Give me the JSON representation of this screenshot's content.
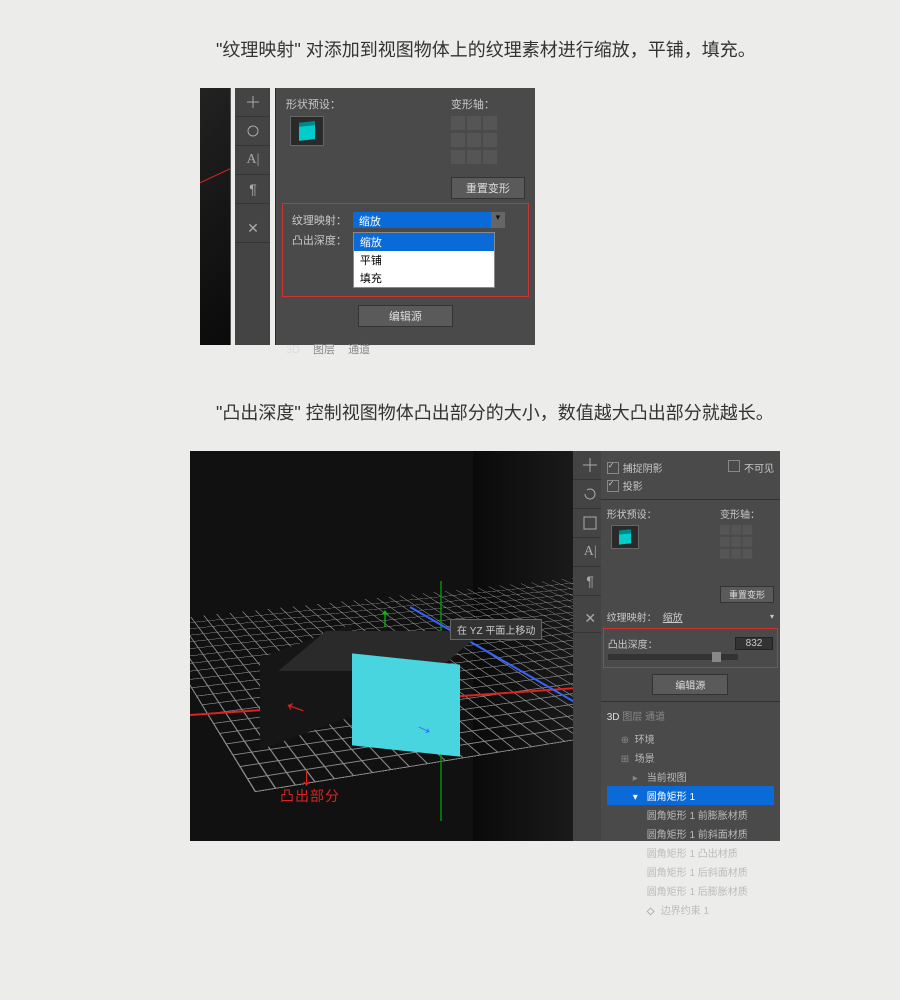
{
  "para1": "\"纹理映射\" 对添加到视图物体上的纹理素材进行缩放，平铺，填充。",
  "para2": "\"凸出深度\" 控制视图物体凸出部分的大小，数值越大凸出部分就越长。",
  "panel1": {
    "shapePreset": "形状预设：",
    "deformAxis": "变形轴：",
    "resetDeform": "重置变形",
    "texMap": "纹理映射：",
    "extrude": "凸出深度：",
    "selected": "缩放",
    "options": [
      "缩放",
      "平铺",
      "填充"
    ],
    "editSource": "编辑源",
    "tabs": [
      "3D",
      "图层",
      "通道"
    ]
  },
  "viewport2": {
    "tooltip": "在 YZ 平面上移动",
    "annotation": "凸出部分"
  },
  "panel2": {
    "captureShadow": "捕捉阴影",
    "invisible": "不可见",
    "castShadow": "投影",
    "shapePreset": "形状预设：",
    "deformAxis": "变形轴：",
    "resetDeform": "重置变形",
    "texMap": "纹理映射：",
    "texMapVal": "缩放",
    "extrude": "凸出深度：",
    "extrudeVal": "832",
    "editSource": "编辑源",
    "tabs": [
      "3D",
      "图层",
      "通道"
    ],
    "tree": {
      "env": "环境",
      "scene": "场景",
      "currentView": "当前视图",
      "rr1": "圆角矩形 1",
      "items": [
        "圆角矩形 1 前膨胀材质",
        "圆角矩形 1 前斜面材质",
        "圆角矩形 1 凸出材质",
        "圆角矩形 1 后斜面材质",
        "圆角矩形 1 后膨胀材质",
        "边界约束 1"
      ]
    }
  }
}
